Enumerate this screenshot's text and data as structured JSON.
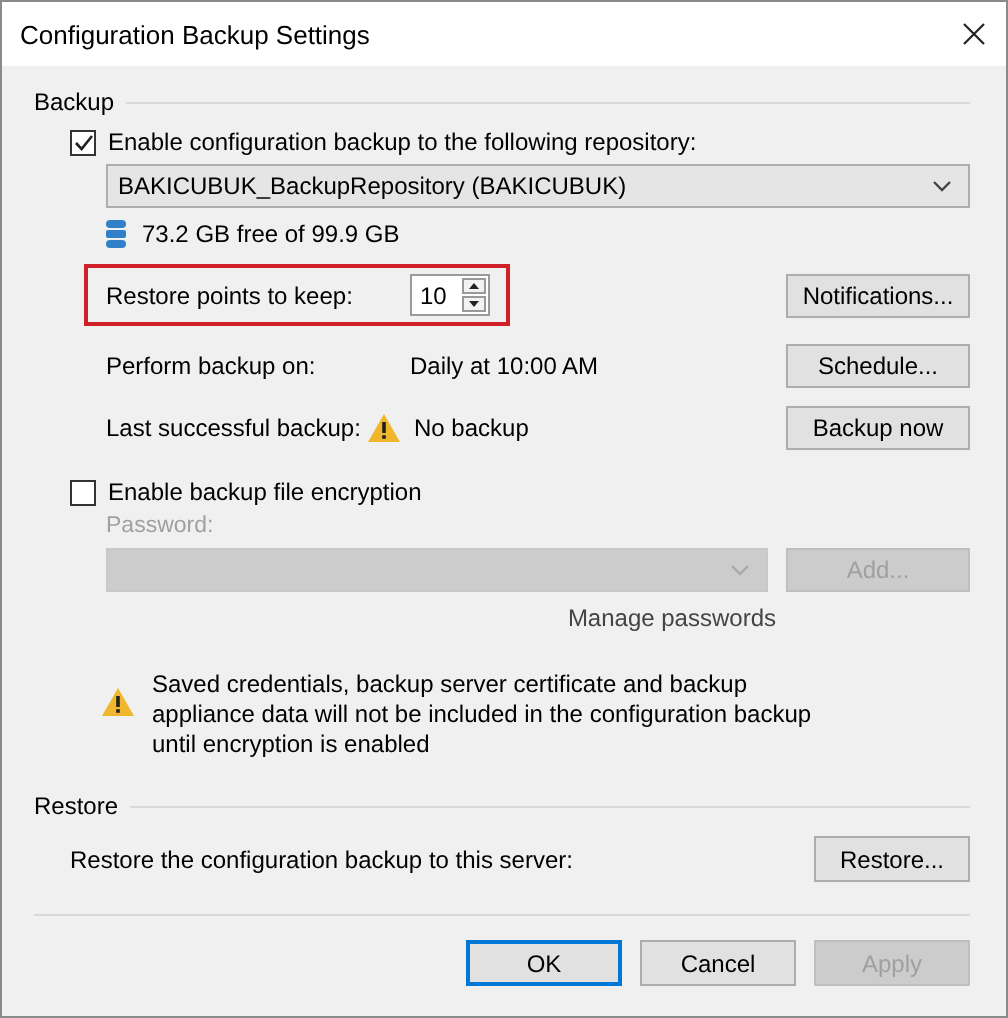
{
  "window": {
    "title": "Configuration Backup Settings"
  },
  "backup": {
    "title": "Backup",
    "enable": {
      "label": "Enable configuration backup to the following repository:",
      "checked": true
    },
    "repository": {
      "value": "BAKICUBUK_BackupRepository (BAKICUBUK)",
      "disabled": false
    },
    "storage": "73.2 GB free of 99.9 GB",
    "restore_points": {
      "label": "Restore points to keep:",
      "value": "10",
      "highlighted": true
    },
    "schedule": {
      "label": "Perform backup on:",
      "value": "Daily at 10:00 AM"
    },
    "last_backup": {
      "label": "Last successful backup:",
      "value": "No backup"
    },
    "buttons": [
      {
        "label": "Notifications...",
        "disabled": false
      },
      {
        "label": "Schedule...",
        "disabled": false
      },
      {
        "label": "Backup now",
        "disabled": false
      }
    ]
  },
  "encryption": {
    "enable": {
      "label": "Enable backup file encryption",
      "checked": false
    },
    "password": {
      "label": "Password:",
      "disabled": true
    },
    "add_button": {
      "label": "Add...",
      "disabled": true
    },
    "manage_link": "Manage passwords",
    "warning": "Saved credentials, backup server certificate and backup appliance data will not be included in the configuration backup until encryption is enabled"
  },
  "restore": {
    "title": "Restore",
    "label": "Restore the configuration backup to this server:",
    "button": {
      "label": "Restore...",
      "disabled": false
    }
  },
  "dialog_buttons": [
    {
      "label": "OK",
      "default": true,
      "disabled": false
    },
    {
      "label": "Cancel",
      "default": false,
      "disabled": false
    },
    {
      "label": "Apply",
      "default": false,
      "disabled": true
    }
  ]
}
